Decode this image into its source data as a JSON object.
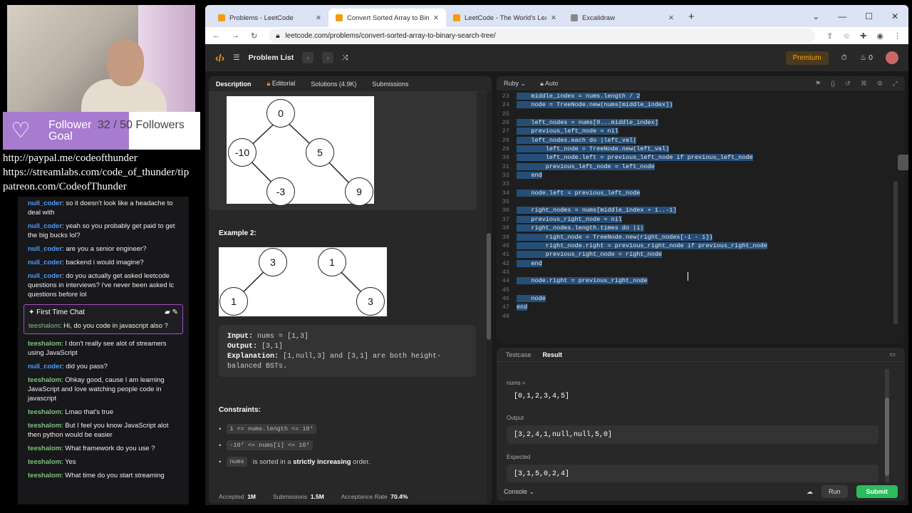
{
  "overlay": {
    "follower_label_1": "Follower",
    "follower_label_2": "Goal",
    "follower_count": "32 / 50 Followers",
    "link_paypal": "http://paypal.me/codeofthunder",
    "link_streamlabs": "https://streamlabs.com/code_of_thunder/tip",
    "link_patreon": "patreon.com/CodeofThunder",
    "follower_progress": 0.64
  },
  "chat": {
    "messages_top": [
      {
        "user": "null_coder",
        "text": "so it doesn't look like a headache to deal with"
      },
      {
        "user": "null_coder",
        "text": "yeah so you probably get paid to get the big bucks lol?"
      },
      {
        "user": "null_coder",
        "text": "are you a senior engineer?"
      },
      {
        "user": "null_coder",
        "text": "backend i would imagine?"
      },
      {
        "user": "null_coder",
        "text": "do you actually get asked leetcode questions in interviews? i've never been asked lc questions before lol"
      }
    ],
    "first_time_chat": {
      "title": "First Time Chat",
      "user": "teeshalom",
      "text": "Hi, do you code in javascript also ?"
    },
    "messages_bottom": [
      {
        "user": "teeshalom",
        "text": "I don't really see alot of streamers using JavaScript"
      },
      {
        "user": "null_coder",
        "text": "did you pass?"
      },
      {
        "user": "teeshalom",
        "text": "Ohkay good, cause I am learning JavaScript and love watching people code in javascript"
      },
      {
        "user": "teeshalom",
        "text": "Lmao that's true"
      },
      {
        "user": "teeshalom",
        "text": "But I feel you know JavaScript alot then python would be easier"
      },
      {
        "user": "teeshalom",
        "text": "What framework do you use ?"
      },
      {
        "user": "teeshalom",
        "text": "Yes"
      },
      {
        "user": "teeshalom",
        "text": "What time do you start streaming"
      }
    ]
  },
  "browser": {
    "tabs": [
      {
        "label": "Problems - LeetCode"
      },
      {
        "label": "Convert Sorted Array to Binary Se"
      },
      {
        "label": "LeetCode - The World's Leading"
      },
      {
        "label": "Excalidraw"
      }
    ],
    "url": "leetcode.com/problems/convert-sorted-array-to-binary-search-tree/"
  },
  "lcnav": {
    "problem_list": "Problem List",
    "premium": "Premium",
    "streak": "0"
  },
  "description": {
    "tabs": [
      "Description",
      "Editorial",
      "Solutions (4.9K)",
      "Submissions"
    ],
    "tree1": [
      "0",
      "-10",
      "5",
      "-3",
      "9"
    ],
    "example2_title": "Example 2:",
    "tree2a": [
      "3",
      "1"
    ],
    "tree2b": [
      "1",
      "3"
    ],
    "input_label": "Input:",
    "input_value": "nums = [1,3]",
    "output_label": "Output:",
    "output_value": "[3,1]",
    "explanation_label": "Explanation:",
    "explanation_value": "[1,null,3] and [3,1] are both height-balanced BSTs.",
    "constraints_title": "Constraints:",
    "constraint_1": "1 <= nums.length <= 10⁴",
    "constraint_2": "-10⁴ <= nums[i] <= 10⁴",
    "constraint_3_code": "nums",
    "constraint_3_pre": "is sorted in a",
    "constraint_3_bold": "strictly increasing",
    "constraint_3_post": "order.",
    "stats": {
      "accepted_label": "Accepted",
      "accepted": "1M",
      "submissions_label": "Submissions",
      "submissions": "1.5M",
      "rate_label": "Acceptance Rate",
      "rate": "70.4%"
    }
  },
  "editor": {
    "language": "Ruby",
    "mode": "Auto",
    "lines": [
      {
        "n": "23",
        "t": "    middle_index = nums.length / 2"
      },
      {
        "n": "24",
        "t": "    node = TreeNode.new(nums[middle_index])"
      },
      {
        "n": "25",
        "t": ""
      },
      {
        "n": "26",
        "t": "    left_nodes = nums[0...middle_index]"
      },
      {
        "n": "27",
        "t": "    previous_left_node = nil"
      },
      {
        "n": "28",
        "t": "    left_nodes.each do |left_val|"
      },
      {
        "n": "29",
        "t": "        left_node = TreeNode.new(left_val)"
      },
      {
        "n": "30",
        "t": "        left_node.left = previous_left_node if previous_left_node"
      },
      {
        "n": "31",
        "t": "        previous_left_node = left_node"
      },
      {
        "n": "32",
        "t": "    end"
      },
      {
        "n": "33",
        "t": ""
      },
      {
        "n": "34",
        "t": "    node.left = previous_left_node"
      },
      {
        "n": "35",
        "t": ""
      },
      {
        "n": "36",
        "t": "    right_nodes = nums[middle_index + 1..-1]"
      },
      {
        "n": "37",
        "t": "    previous_right_node = nil"
      },
      {
        "n": "38",
        "t": "    right_nodes.length.times do |i|"
      },
      {
        "n": "39",
        "t": "        right_node = TreeNode.new(right_nodes[-i - 1])"
      },
      {
        "n": "40",
        "t": "        right_node.right = previous_right_node if previous_right_node"
      },
      {
        "n": "41",
        "t": "        previous_right_node = right_node"
      },
      {
        "n": "42",
        "t": "    end"
      },
      {
        "n": "43",
        "t": ""
      },
      {
        "n": "44",
        "t": "    node.right = previous_right_node"
      },
      {
        "n": "45",
        "t": ""
      },
      {
        "n": "46",
        "t": "    node"
      },
      {
        "n": "47",
        "t": "end"
      },
      {
        "n": "48",
        "t": ""
      }
    ]
  },
  "result": {
    "tabs": [
      "Testcase",
      "Result"
    ],
    "input_label": "nums =",
    "input_value": "[0,1,2,3,4,5]",
    "output_label": "Output",
    "output_value": "[3,2,4,1,null,null,5,0]",
    "expected_label": "Expected",
    "expected_value": "[3,1,5,0,2,4]",
    "console": "Console",
    "run": "Run",
    "submit": "Submit"
  }
}
